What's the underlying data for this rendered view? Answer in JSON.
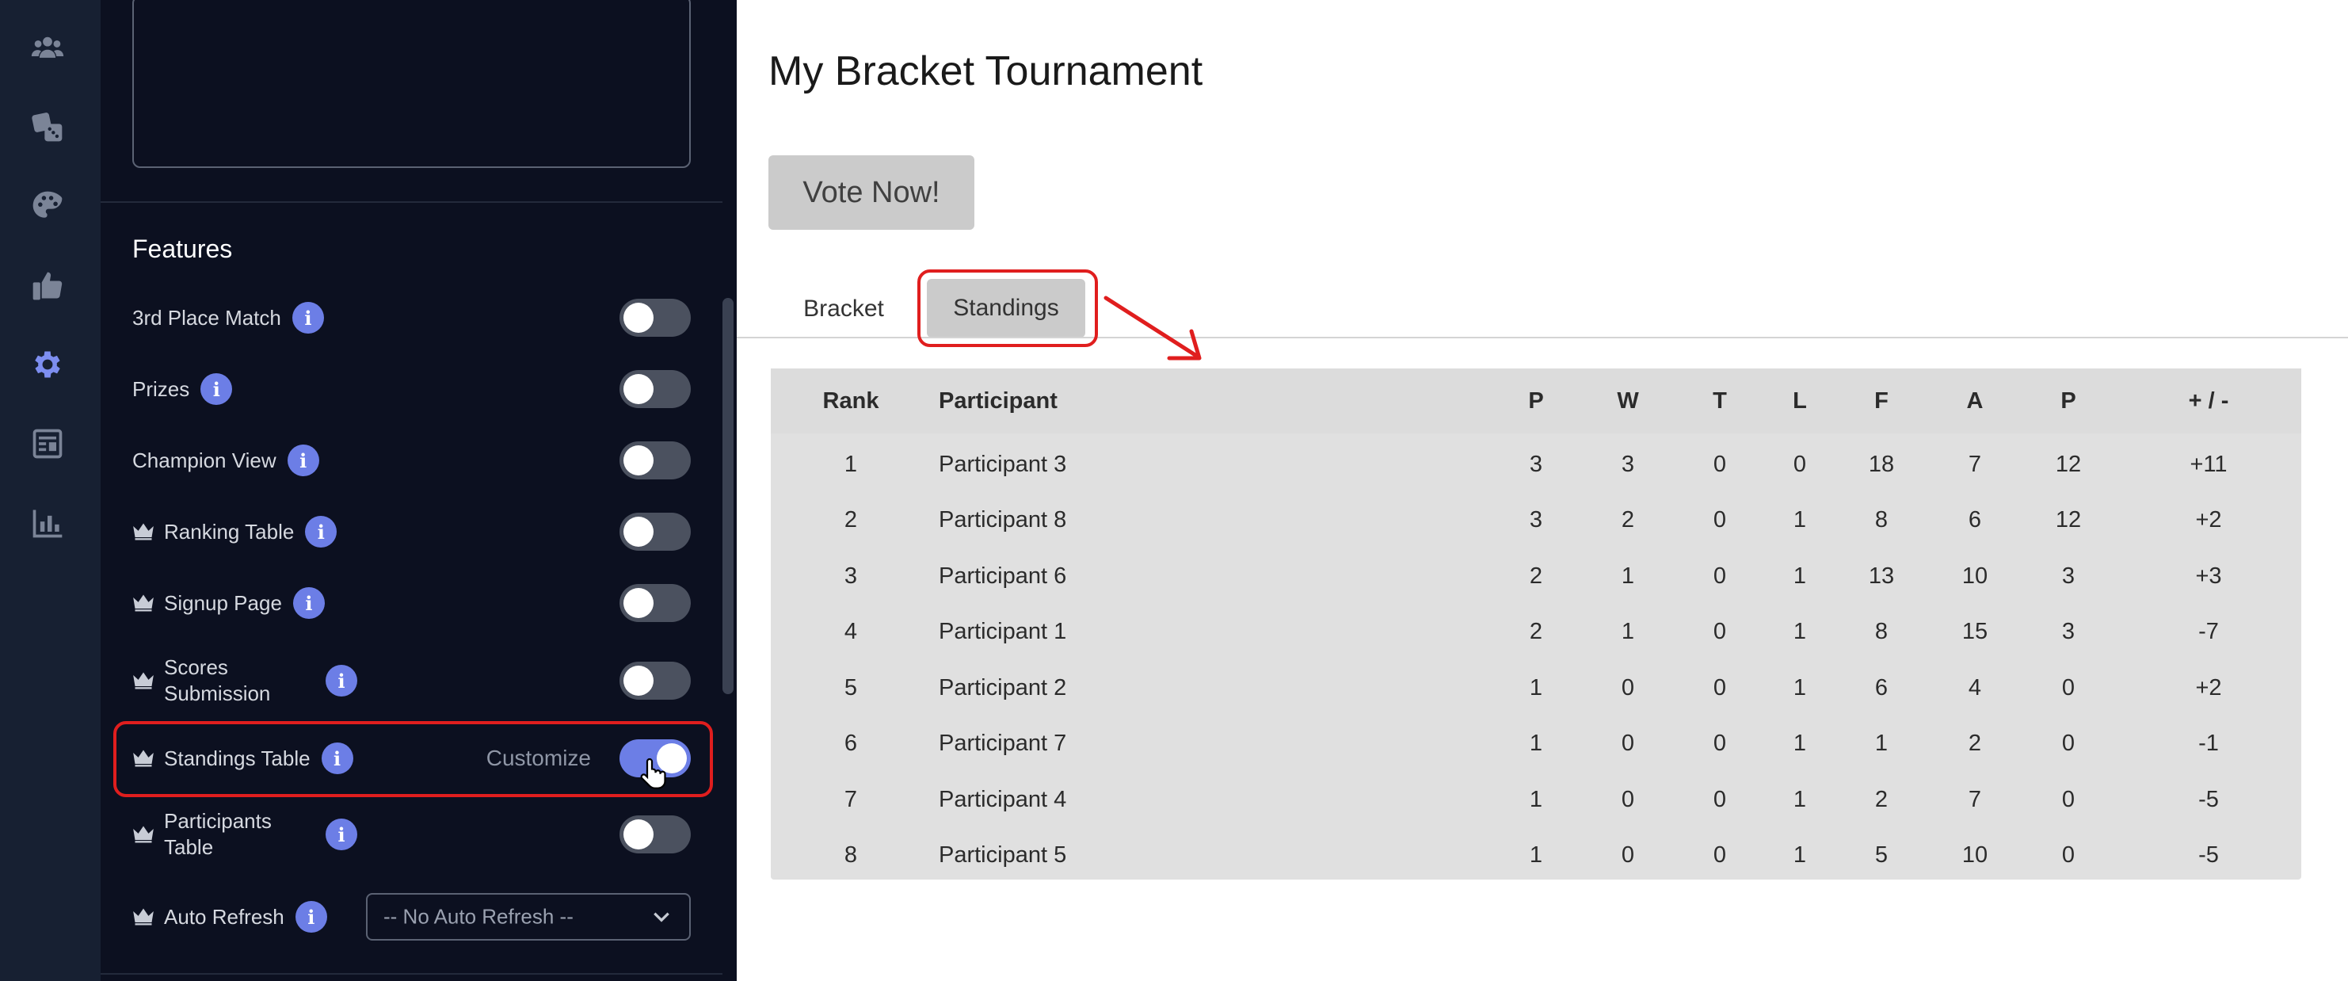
{
  "rail": {
    "icons": [
      "users-icon",
      "dice-icon",
      "palette-icon",
      "thumbs-up-icon",
      "gear-icon",
      "newspaper-icon",
      "bar-chart-icon"
    ],
    "active_icon": "gear-icon"
  },
  "panel": {
    "features_title": "Features",
    "features": [
      {
        "label": "3rd Place Match",
        "premium": false,
        "on": false
      },
      {
        "label": "Prizes",
        "premium": false,
        "on": false
      },
      {
        "label": "Champion View",
        "premium": false,
        "on": false
      },
      {
        "label": "Ranking Table",
        "premium": true,
        "on": false
      },
      {
        "label": "Signup Page",
        "premium": true,
        "on": false
      },
      {
        "label": "Scores Submission",
        "premium": true,
        "on": false
      },
      {
        "label": "Standings Table",
        "premium": true,
        "on": true,
        "action": "Customize"
      },
      {
        "label": "Participants Table",
        "premium": true,
        "on": false
      }
    ],
    "auto_refresh": {
      "label": "Auto Refresh",
      "premium": true,
      "value": "-- No Auto Refresh --"
    }
  },
  "main": {
    "title": "My Bracket Tournament",
    "vote_button": "Vote Now!",
    "tabs": [
      {
        "label": "Bracket",
        "active": false
      },
      {
        "label": "Standings",
        "active": true
      }
    ],
    "table": {
      "headers": [
        "Rank",
        "Participant",
        "P",
        "W",
        "T",
        "L",
        "F",
        "A",
        "P",
        "+ / -"
      ],
      "rows": [
        [
          "1",
          "Participant 3",
          "3",
          "3",
          "0",
          "0",
          "18",
          "7",
          "12",
          "+11"
        ],
        [
          "2",
          "Participant 8",
          "3",
          "2",
          "0",
          "1",
          "8",
          "6",
          "12",
          "+2"
        ],
        [
          "3",
          "Participant 6",
          "2",
          "1",
          "0",
          "1",
          "13",
          "10",
          "3",
          "+3"
        ],
        [
          "4",
          "Participant 1",
          "2",
          "1",
          "0",
          "1",
          "8",
          "15",
          "3",
          "-7"
        ],
        [
          "5",
          "Participant 2",
          "1",
          "0",
          "0",
          "1",
          "6",
          "4",
          "0",
          "+2"
        ],
        [
          "6",
          "Participant 7",
          "1",
          "0",
          "0",
          "1",
          "1",
          "2",
          "0",
          "-1"
        ],
        [
          "7",
          "Participant 4",
          "1",
          "0",
          "0",
          "1",
          "2",
          "7",
          "0",
          "-5"
        ],
        [
          "8",
          "Participant 5",
          "1",
          "0",
          "0",
          "1",
          "5",
          "10",
          "0",
          "-5"
        ]
      ]
    }
  },
  "colors": {
    "accent": "#6c7ee6",
    "highlight": "#e01e1e",
    "panel_bg": "#0c1020",
    "rail_bg": "#172032"
  }
}
